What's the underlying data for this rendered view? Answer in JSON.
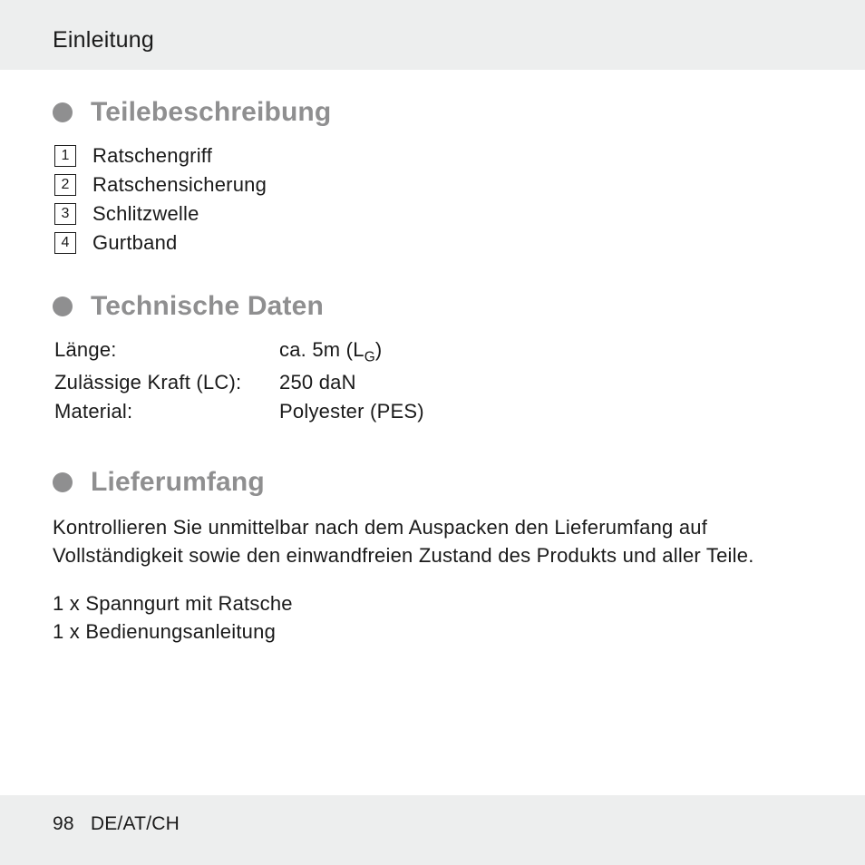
{
  "header": "Einleitung",
  "sections": {
    "parts": {
      "title": "Teilebeschreibung",
      "items": [
        {
          "n": "1",
          "label": "Ratschengriff"
        },
        {
          "n": "2",
          "label": "Ratschensicherung"
        },
        {
          "n": "3",
          "label": "Schlitzwelle"
        },
        {
          "n": "4",
          "label": "Gurtband"
        }
      ]
    },
    "specs": {
      "title": "Technische Daten",
      "rows": [
        {
          "k": "Länge:",
          "v_pre": "ca. 5m (L",
          "v_sub": "G",
          "v_post": ")"
        },
        {
          "k": "Zulässige Kraft (LC):",
          "v_pre": "250 daN",
          "v_sub": "",
          "v_post": ""
        },
        {
          "k": "Material:",
          "v_pre": "Polyester (PES)",
          "v_sub": "",
          "v_post": ""
        }
      ]
    },
    "scope": {
      "title": "Lieferumfang",
      "text": "Kontrollieren Sie unmittelbar nach dem Auspacken den Lieferumfang auf Vollständigkeit sowie den einwandfreien Zustand des Produkts und aller Teile.",
      "items": [
        "1 x Spanngurt mit Ratsche",
        "1 x Bedienungsanleitung"
      ]
    }
  },
  "footer": {
    "page": "98",
    "locale": "DE/AT/CH"
  }
}
